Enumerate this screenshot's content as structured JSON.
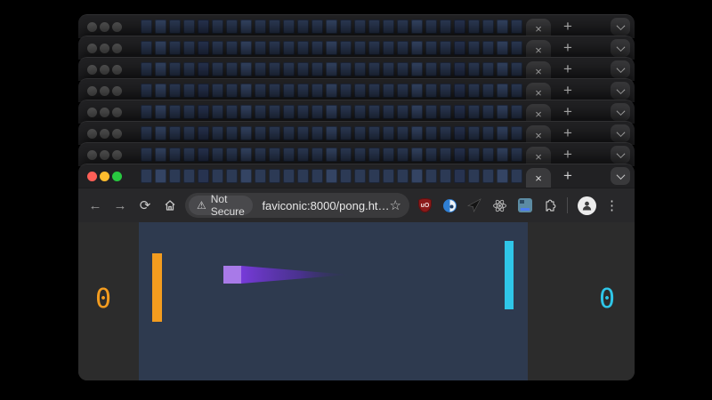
{
  "window_stack": {
    "window_count": 8,
    "inactive_count": 7,
    "favicons_per_row": 27,
    "close_label": "×",
    "new_tab_label": "+",
    "tab_overflow_icon": "chevron-down"
  },
  "traffic_lights": {
    "close": "#ff5f57",
    "minimize": "#febc2e",
    "zoom": "#28c840",
    "inactive": "#565656"
  },
  "toolbar": {
    "back_icon": "←",
    "forward_icon": "→",
    "reload_icon": "⟳",
    "home_icon": "home",
    "security_chip": {
      "warning_icon": "⚠",
      "label": "Not Secure"
    },
    "url": "faviconic:8000/pong.ht…",
    "bookmark_icon": "☆",
    "extensions": [
      "ublock-origin",
      "blue-circle-extension",
      "cursor-pin-extension",
      "react-devtools",
      "screen-panel-extension",
      "extensions-menu"
    ],
    "ubo_glyph": "uO",
    "menu_icon": "⋮"
  },
  "game": {
    "left_score": "0",
    "right_score": "0",
    "colors": {
      "canvas_bg": "#2e3a4f",
      "page_bg": "#2c2c2c",
      "left_paddle": "#f39c1f",
      "right_paddle": "#2fc6e8",
      "ball": "#a87ae8",
      "trail_start": "#7b3be0",
      "trail_mid": "#5f2cc0"
    }
  }
}
